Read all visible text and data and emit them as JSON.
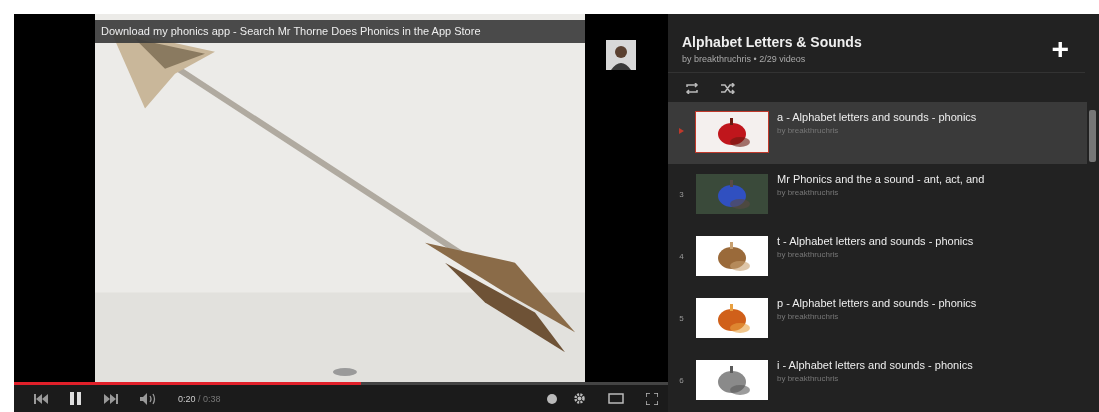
{
  "annotation": "Download my phonics app - Search Mr Thorne Does Phonics in the App Store",
  "player": {
    "playing": true,
    "level": 0.53,
    "time_current": "0:20",
    "time_total": "/ 0:38"
  },
  "playlist": {
    "title": "Alphabet Letters & Sounds",
    "meta": "by breakthruchris • 2/29 videos",
    "add": "+",
    "items": [
      {
        "selected": true,
        "title": "a - Alphabet letters and sounds - phonics",
        "by": "by breakthruchris"
      },
      {
        "selected": false,
        "index": "3",
        "title": "Mr Phonics and the a sound - ant, act, and",
        "by": "by breakthruchris"
      },
      {
        "selected": false,
        "index": "4",
        "title": "t - Alphabet letters and sounds - phonics",
        "by": "by breakthruchris"
      },
      {
        "selected": false,
        "index": "5",
        "title": "p - Alphabet letters and sounds - phonics",
        "by": "by breakthruchris"
      },
      {
        "selected": false,
        "index": "6",
        "title": "i - Alphabet letters and sounds - phonics",
        "by": "by breakthruchris"
      }
    ]
  }
}
